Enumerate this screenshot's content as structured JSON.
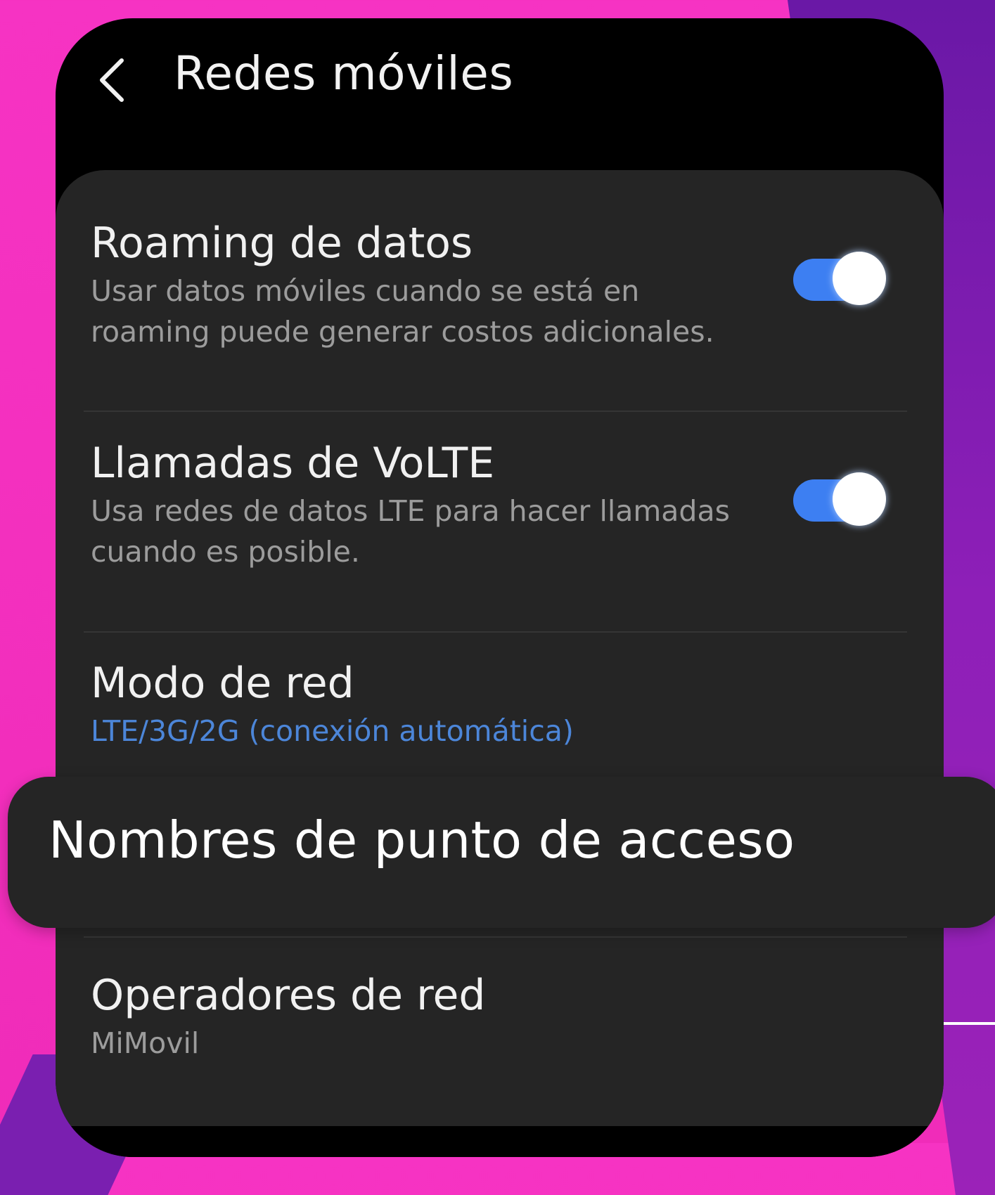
{
  "header": {
    "title": "Redes móviles"
  },
  "settings": {
    "roaming": {
      "title": "Roaming de datos",
      "subtitle": "Usar datos móviles cuando se está en roaming puede generar costos adicionales.",
      "enabled": true
    },
    "volte": {
      "title": "Llamadas de VoLTE",
      "subtitle": "Usa redes de datos LTE para hacer llamadas cuando es posible.",
      "enabled": true
    },
    "network_mode": {
      "title": "Modo de red",
      "value": "LTE/3G/2G (conexión automática)"
    },
    "apn": {
      "title": "Nombres de punto de acceso"
    },
    "operators": {
      "title": "Operadores de red",
      "value": "MiMovil"
    }
  },
  "colors": {
    "accent": "#3d7ff2",
    "link": "#4c86d9",
    "background_pink": "#f633c3",
    "background_purple": "#8e1fb8",
    "card": "#252525"
  }
}
